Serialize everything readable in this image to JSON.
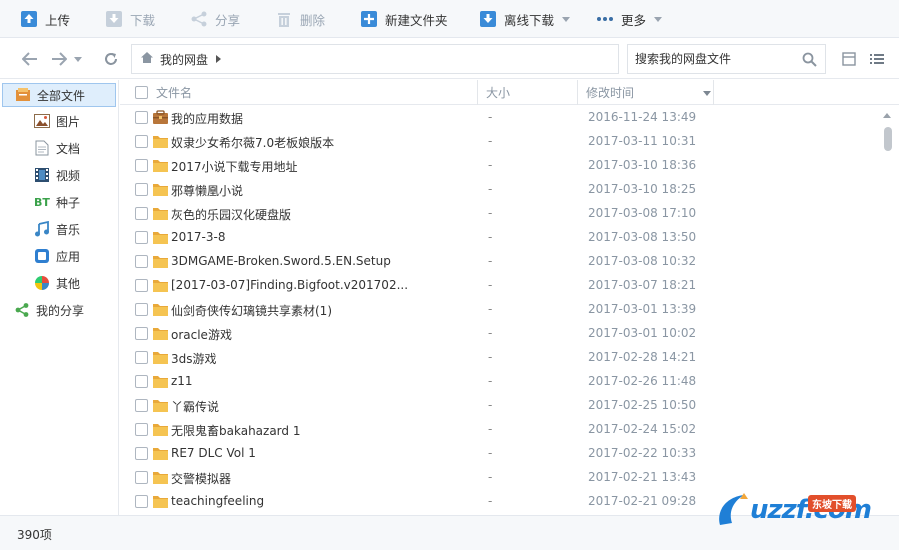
{
  "toolbar": {
    "upload": "上传",
    "download": "下载",
    "share": "分享",
    "delete": "删除",
    "new_folder": "新建文件夹",
    "offline_download": "离线下载",
    "more": "更多"
  },
  "nav": {
    "breadcrumb": "我的网盘",
    "search_placeholder": "搜索我的网盘文件"
  },
  "sidebar": {
    "items": [
      {
        "label": "全部文件",
        "icon": "all-files-icon"
      },
      {
        "label": "图片",
        "icon": "image-icon"
      },
      {
        "label": "文档",
        "icon": "document-icon"
      },
      {
        "label": "视频",
        "icon": "video-icon"
      },
      {
        "label": "种子",
        "icon": "bt-torrent-icon"
      },
      {
        "label": "音乐",
        "icon": "music-icon"
      },
      {
        "label": "应用",
        "icon": "app-icon"
      },
      {
        "label": "其他",
        "icon": "other-icon"
      },
      {
        "label": "我的分享",
        "icon": "share-icon"
      }
    ]
  },
  "list": {
    "headers": {
      "name": "文件名",
      "size": "大小",
      "modified": "修改时间"
    },
    "rows": [
      {
        "name": "我的应用数据",
        "size": "-",
        "modified": "2016-11-24 13:49",
        "type": "app-folder"
      },
      {
        "name": "奴隶少女希尔薇7.0老板娘版本",
        "size": "-",
        "modified": "2017-03-11 10:31",
        "type": "folder"
      },
      {
        "name": "2017小说下载专用地址",
        "size": "-",
        "modified": "2017-03-10 18:36",
        "type": "folder"
      },
      {
        "name": "邪尊懒凰小说",
        "size": "-",
        "modified": "2017-03-10 18:25",
        "type": "folder"
      },
      {
        "name": "灰色的乐园汉化硬盘版",
        "size": "-",
        "modified": "2017-03-08 17:10",
        "type": "folder"
      },
      {
        "name": "2017-3-8",
        "size": "-",
        "modified": "2017-03-08 13:50",
        "type": "folder"
      },
      {
        "name": "3DMGAME-Broken.Sword.5.EN.Setup",
        "size": "-",
        "modified": "2017-03-08 10:32",
        "type": "folder"
      },
      {
        "name": "[2017-03-07]Finding.Bigfoot.v201702...",
        "size": "-",
        "modified": "2017-03-07 18:21",
        "type": "folder"
      },
      {
        "name": "仙剑奇侠传幻璃镜共享素材(1)",
        "size": "-",
        "modified": "2017-03-01 13:39",
        "type": "folder"
      },
      {
        "name": "oracle游戏",
        "size": "-",
        "modified": "2017-03-01 10:02",
        "type": "folder"
      },
      {
        "name": "3ds游戏",
        "size": "-",
        "modified": "2017-02-28 14:21",
        "type": "folder"
      },
      {
        "name": "z11",
        "size": "-",
        "modified": "2017-02-26 11:48",
        "type": "folder"
      },
      {
        "name": "丫霸传说",
        "size": "-",
        "modified": "2017-02-25 10:50",
        "type": "folder"
      },
      {
        "name": "无限鬼畜bakahazard 1",
        "size": "-",
        "modified": "2017-02-24 15:02",
        "type": "folder"
      },
      {
        "name": "RE7 DLC Vol 1",
        "size": "-",
        "modified": "2017-02-22 10:33",
        "type": "folder"
      },
      {
        "name": "交警模拟器",
        "size": "-",
        "modified": "2017-02-21 13:43",
        "type": "folder"
      },
      {
        "name": "teachingfeeling",
        "size": "-",
        "modified": "2017-02-21 09:28",
        "type": "folder"
      }
    ]
  },
  "status": {
    "count": "390项"
  },
  "watermark": {
    "text": "uzzf.com",
    "tag": "东坡下载"
  },
  "colors": {
    "accent": "#1f7fd6",
    "folder": "#f5c452",
    "selected_bg": "#dfeefc"
  }
}
